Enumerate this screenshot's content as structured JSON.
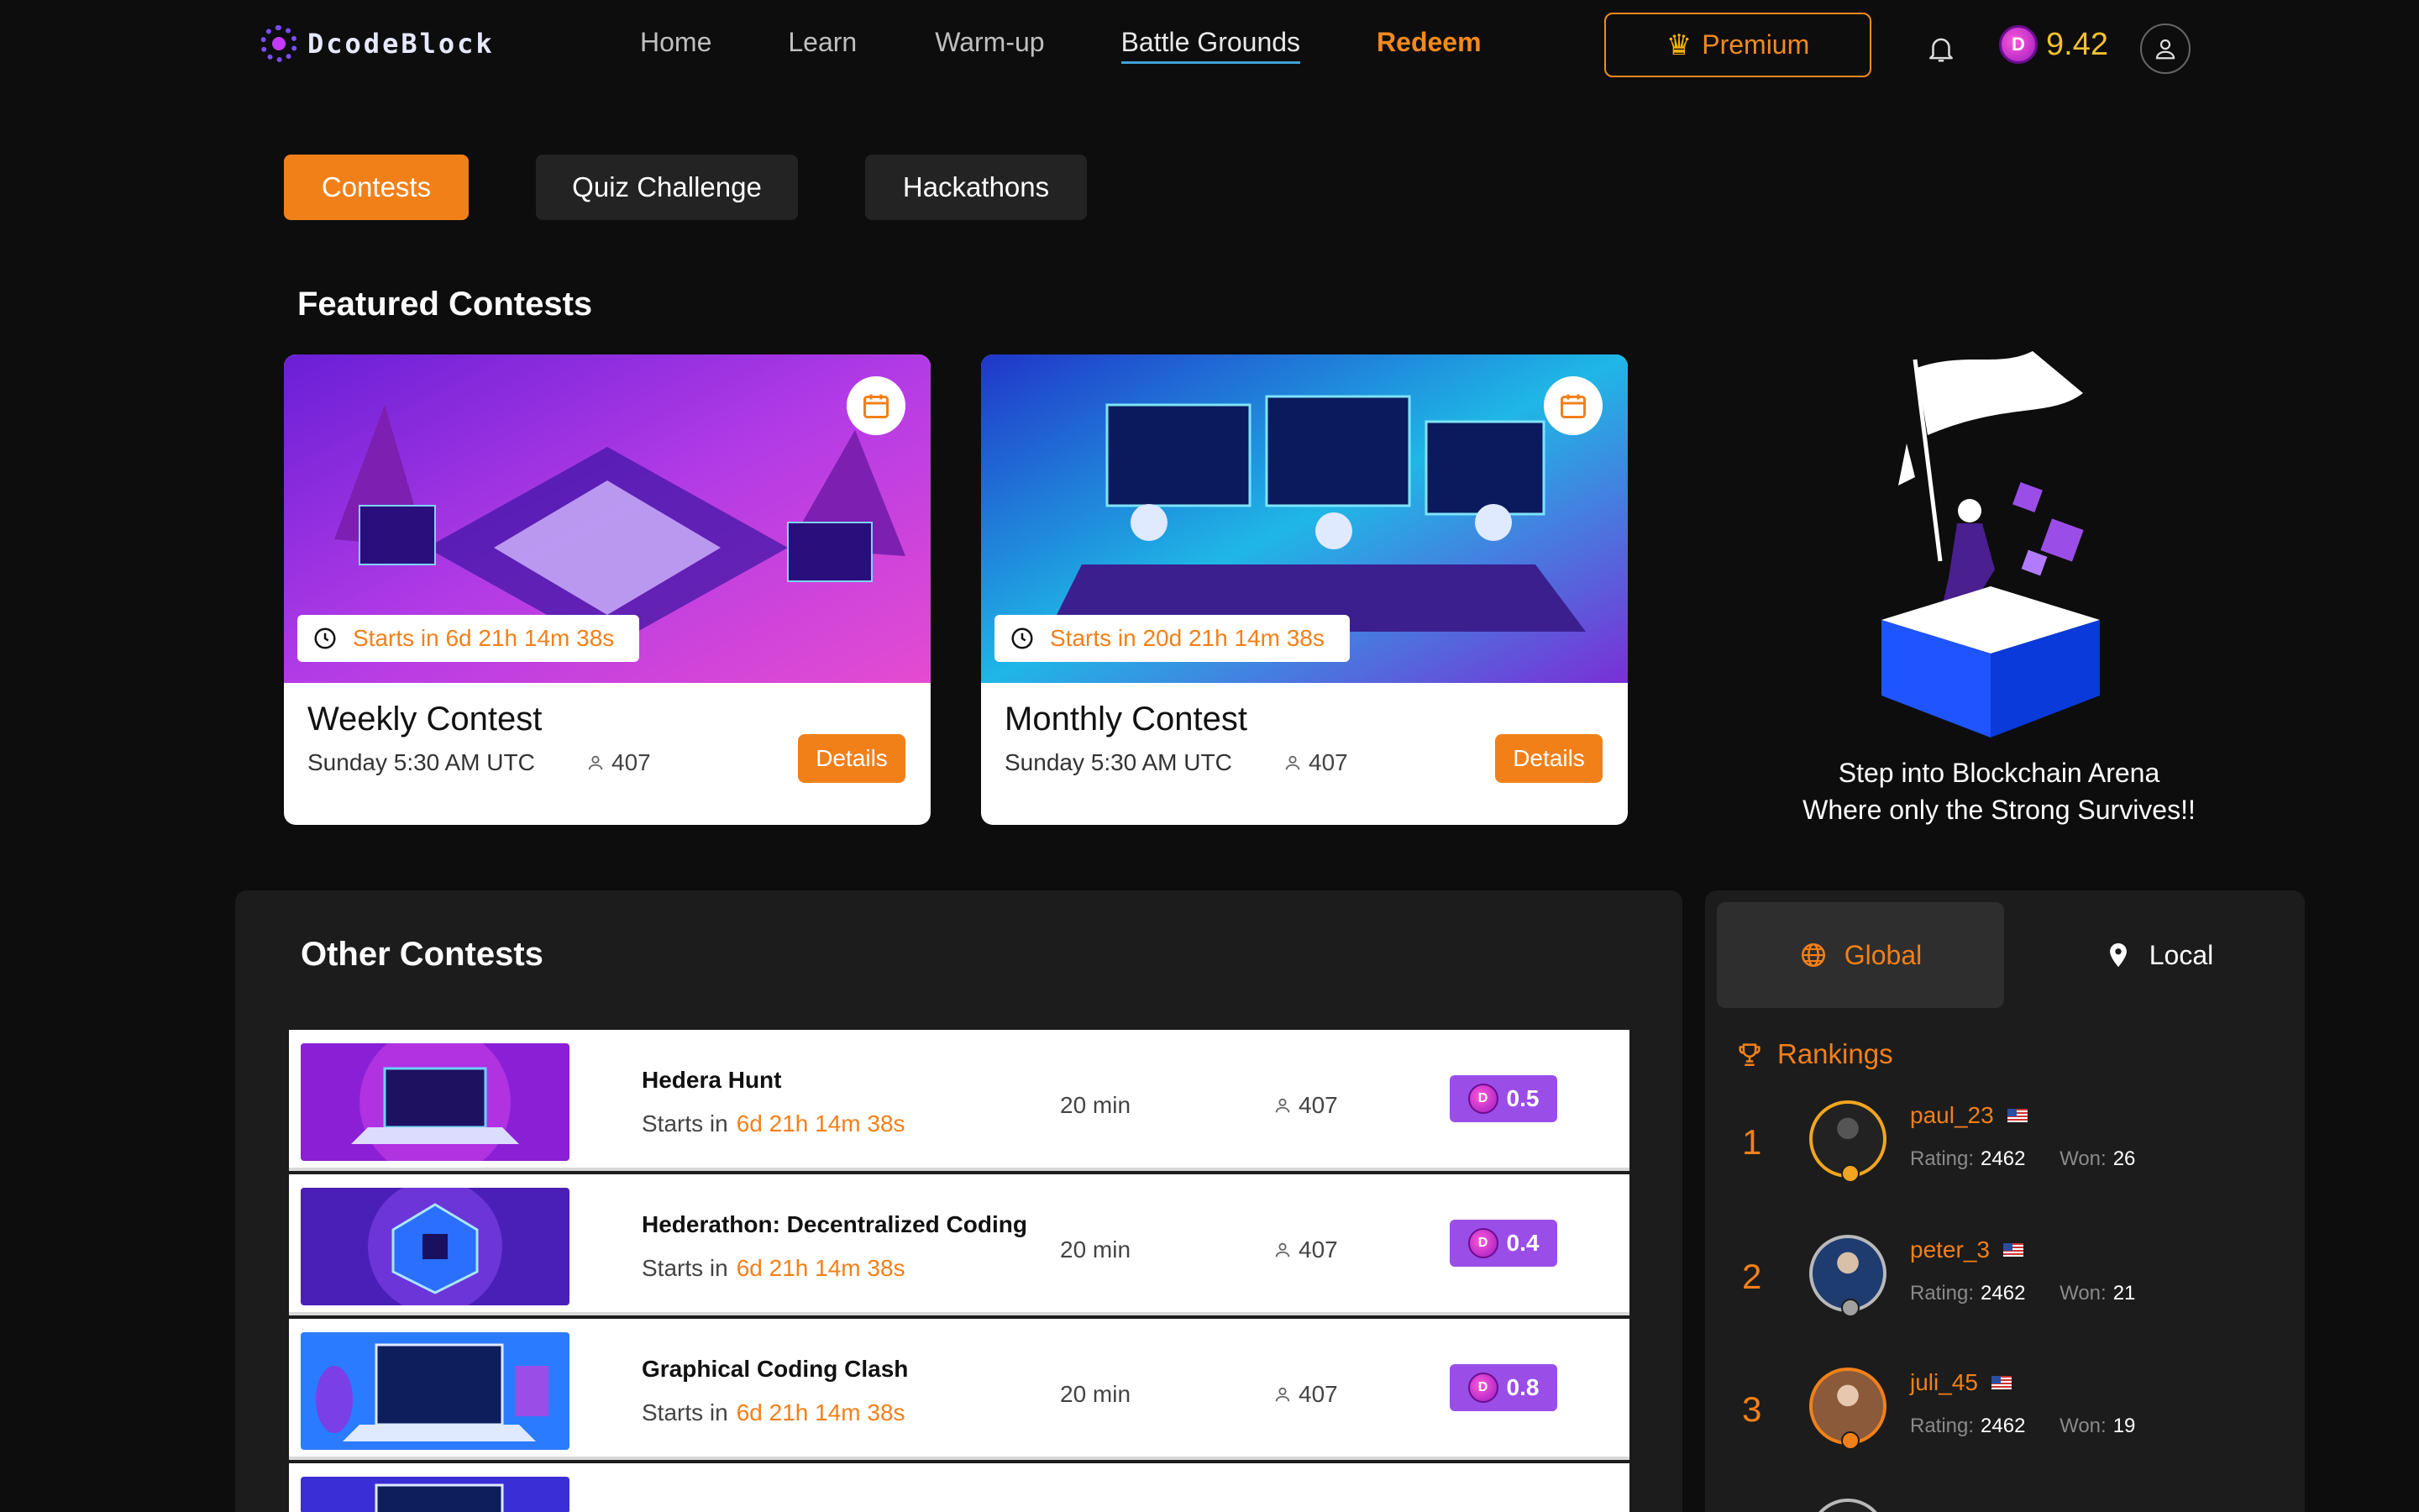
{
  "brand": {
    "name": "DcodeBlock"
  },
  "nav": {
    "items": [
      "Home",
      "Learn",
      "Warm-up",
      "Battle Grounds",
      "Redeem"
    ],
    "active": "Battle Grounds"
  },
  "header": {
    "premium_label": "Premium",
    "balance": "9.42",
    "coin_glyph": "D"
  },
  "tabs": [
    "Contests",
    "Quiz Challenge",
    "Hackathons"
  ],
  "featured": {
    "title": "Featured Contests",
    "cards": [
      {
        "title": "Weekly Contest",
        "starts": "Starts in 6d 21h 14m 38s",
        "schedule": "Sunday 5:30 AM UTC",
        "participants": "407",
        "details_label": "Details"
      },
      {
        "title": "Monthly Contest",
        "starts": "Starts in 20d 21h 14m 38s",
        "schedule": "Sunday 5:30 AM UTC",
        "participants": "407",
        "details_label": "Details"
      }
    ]
  },
  "hero": {
    "line1": "Step into Blockchain Arena",
    "line2": "Where only the Strong Survives!!"
  },
  "other": {
    "title": "Other Contests",
    "starts_prefix": "Starts in",
    "rows": [
      {
        "title": "Hedera Hunt",
        "starts": "6d 21h 14m 38s",
        "duration": "20 min",
        "participants": "407",
        "reward": "0.5"
      },
      {
        "title": "Hederathon: Decentralized Coding",
        "starts": "6d 21h 14m 38s",
        "duration": "20 min",
        "participants": "407",
        "reward": "0.4"
      },
      {
        "title": "Graphical Coding Clash",
        "starts": "6d 21h 14m 38s",
        "duration": "20 min",
        "participants": "407",
        "reward": "0.8"
      }
    ]
  },
  "rankings": {
    "scope": [
      "Global",
      "Local"
    ],
    "title": "Rankings",
    "rating_label": "Rating:",
    "won_label": "Won:",
    "players": [
      {
        "rank": "1",
        "name": "paul_23",
        "rating": "2462",
        "won": "26"
      },
      {
        "rank": "2",
        "name": "peter_3",
        "rating": "2462",
        "won": "21"
      },
      {
        "rank": "3",
        "name": "juli_45",
        "rating": "2462",
        "won": "19"
      }
    ]
  },
  "colors": {
    "accent": "#f28019",
    "reward": "#9b4de8",
    "panel": "#1c1c1c",
    "background": "#0d0d0d"
  }
}
